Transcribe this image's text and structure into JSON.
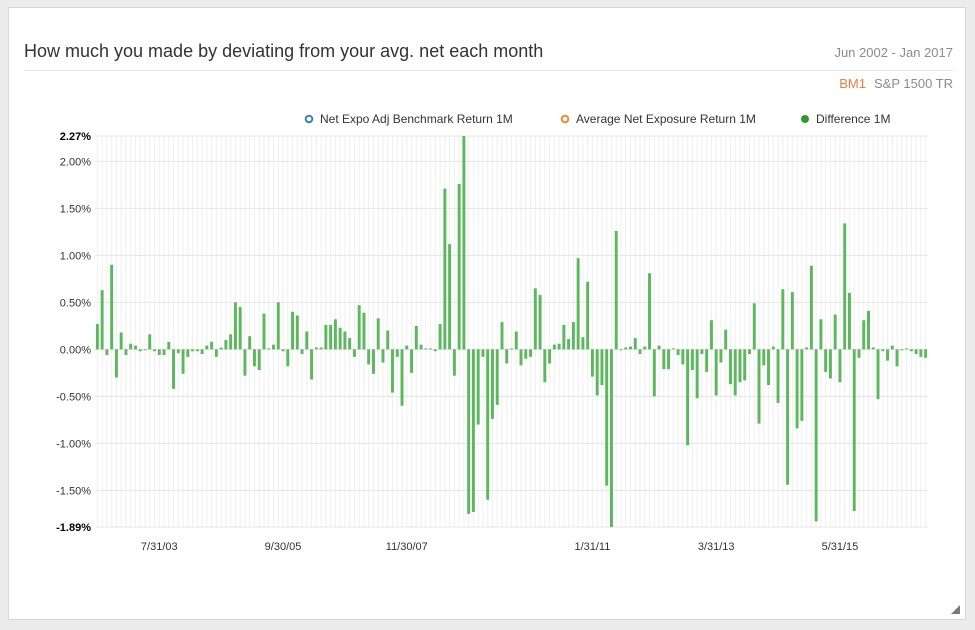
{
  "title": "How much you made by deviating from your avg. net each month",
  "date_range": "Jun 2002 - Jan 2017",
  "benchmark_label": "BM1",
  "benchmark_name": "S&P 1500 TR",
  "colors": {
    "difference": "#5cb85c",
    "benchmark": "#3a7cc3",
    "average": "#ee8a2e",
    "bm1": "#ee7d3a"
  },
  "chart_data": {
    "type": "bar",
    "legend": [
      {
        "name": "Net Expo Adj Benchmark Return 1M",
        "marker": "hollow-circle",
        "color": "#3a7cc3"
      },
      {
        "name": "Average Net Exposure Return 1M",
        "marker": "hollow-circle",
        "color": "#ee8a2e"
      },
      {
        "name": "Difference 1M",
        "marker": "filled-circle",
        "color": "#2e9a2e"
      }
    ],
    "legend_position": "top-right",
    "y_range": [
      -0.0189,
      0.0227
    ],
    "y_ticks": [
      {
        "value": 0.0227,
        "label": "2.27%",
        "bold": true
      },
      {
        "value": 0.02,
        "label": "2.00%"
      },
      {
        "value": 0.015,
        "label": "1.50%"
      },
      {
        "value": 0.01,
        "label": "1.00%"
      },
      {
        "value": 0.005,
        "label": "0.50%"
      },
      {
        "value": 0,
        "label": "0.00%"
      },
      {
        "value": -0.005,
        "label": "-0.50%"
      },
      {
        "value": -0.01,
        "label": "-1.00%"
      },
      {
        "value": -0.015,
        "label": "-1.50%"
      },
      {
        "value": -0.0189,
        "label": "-1.89%",
        "bold": true
      }
    ],
    "x_ticks": [
      {
        "index": 13,
        "label": "7/31/03"
      },
      {
        "index": 39,
        "label": "9/30/05"
      },
      {
        "index": 65,
        "label": "11/30/07"
      },
      {
        "index": 104,
        "label": "1/31/11"
      },
      {
        "index": 130,
        "label": "3/31/13"
      },
      {
        "index": 156,
        "label": "5/31/15"
      }
    ],
    "grid": true,
    "series": [
      {
        "name": "Difference 1M",
        "values": [
          0.0027,
          0.0063,
          -0.0006,
          0.009,
          -0.003,
          0.0018,
          -0.0006,
          0.0006,
          0.0004,
          -0.0002,
          -0.0001,
          0.0016,
          -0.0002,
          -0.0006,
          -0.0006,
          0.0008,
          -0.0042,
          -0.0004,
          -0.0026,
          -0.0008,
          -0.0002,
          -0.0002,
          -0.0005,
          0.0004,
          0.0008,
          -0.0008,
          0.0002,
          0.001,
          0.0016,
          0.005,
          0.0045,
          -0.0028,
          0.0014,
          -0.0018,
          -0.0022,
          0.0038,
          0.0001,
          0.0005,
          0.005,
          -0.0002,
          -0.0018,
          0.004,
          0.0036,
          -0.0005,
          0.0019,
          -0.0032,
          0.0002,
          0.0002,
          0.0026,
          0.0026,
          0.0032,
          0.0023,
          0.0019,
          0.0012,
          -0.0008,
          0.0047,
          0.0039,
          -0.0016,
          -0.0026,
          0.0033,
          -0.0014,
          0.002,
          -0.0046,
          -0.0008,
          -0.006,
          0.0004,
          -0.0025,
          0.0025,
          0.0005,
          0.0001,
          0.0001,
          -0.0002,
          0.0027,
          0.0171,
          0.0112,
          -0.0028,
          0.0176,
          0.0227,
          -0.0175,
          -0.0173,
          -0.008,
          -0.0008,
          -0.016,
          -0.0074,
          -0.0059,
          0.0029,
          -0.0015,
          0.0001,
          0.0019,
          -0.0017,
          -0.001,
          -0.0008,
          0.0065,
          0.0058,
          -0.0035,
          -0.0015,
          0.0005,
          0.0006,
          0.0026,
          0.0011,
          0.0029,
          0.0097,
          0.0013,
          0.0072,
          -0.0029,
          -0.0049,
          -0.0038,
          -0.0145,
          -0.0189,
          0.0126,
          -0.0001,
          0.0002,
          0.0003,
          0.0012,
          -0.0005,
          0.0003,
          0.0081,
          -0.005,
          0.0004,
          -0.0021,
          -0.0021,
          0.0001,
          -0.0006,
          -0.0016,
          -0.0102,
          -0.0022,
          -0.0052,
          -0.0005,
          -0.0024,
          0.0031,
          -0.0049,
          -0.0014,
          0.0021,
          -0.0037,
          -0.0049,
          -0.0035,
          -0.0033,
          -0.0005,
          0.0049,
          -0.0079,
          -0.0017,
          -0.0038,
          0.0003,
          -0.0057,
          0.0064,
          -0.0144,
          0.0061,
          -0.0084,
          -0.0076,
          0.0002,
          0.0089,
          -0.0183,
          0.0032,
          -0.0024,
          -0.0031,
          0.0037,
          -0.0035,
          0.0134,
          0.006,
          -0.0172,
          -0.0009,
          0.0031,
          0.0041,
          0.0002,
          -0.0053,
          -0.0002,
          -0.0012,
          0.0004,
          -0.0018,
          -0.0001,
          0.0001,
          -0.0002,
          -0.0005,
          -0.0008,
          -0.0009
        ]
      }
    ]
  }
}
